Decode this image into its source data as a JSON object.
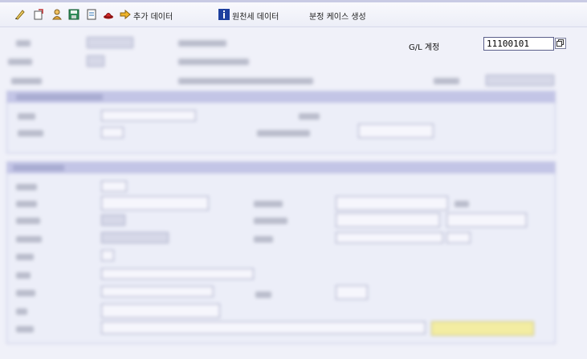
{
  "toolbar": {
    "additional_data": "추가 데이터",
    "source_doc_data": "원천세 데이터",
    "create_split_case": "분정 케이스 생성"
  },
  "gl_account": {
    "label": "G/L 계정",
    "value": "11100101"
  },
  "colors": {
    "panel_header": "#c3c5e6",
    "background": "#f0f1f9",
    "toolbar_bg": "#eceef7",
    "action_button": "#f3eda2"
  }
}
